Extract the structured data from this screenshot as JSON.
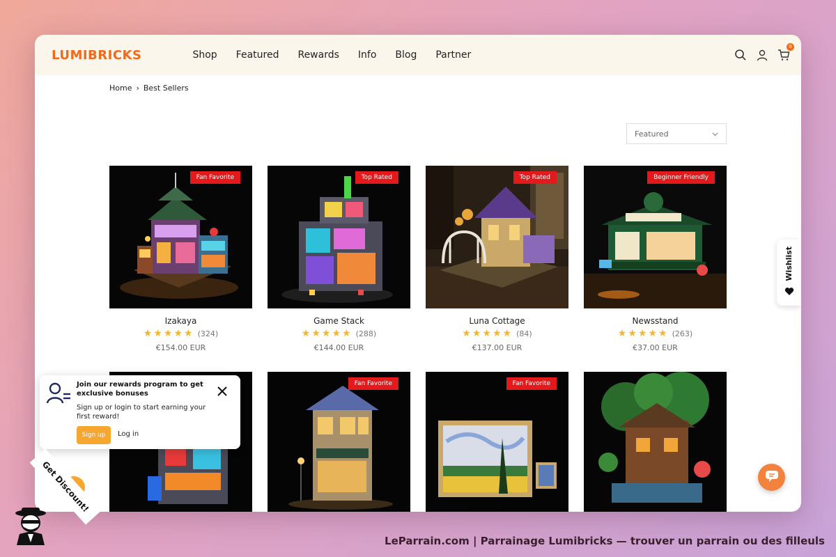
{
  "brand": {
    "logo": "LUMIBRICKS",
    "accent": "#f06a1c"
  },
  "nav": {
    "items": [
      "Shop",
      "Featured",
      "Rewards",
      "Info",
      "Blog",
      "Partner"
    ]
  },
  "header_icons": {
    "search": "search-icon",
    "account": "user-icon",
    "cart": "cart-icon",
    "cart_count": "0"
  },
  "breadcrumb": {
    "home": "Home",
    "separator": "›",
    "current": "Best Sellers"
  },
  "sort": {
    "selected": "Featured"
  },
  "products": [
    {
      "name": "Izakaya",
      "badge": "Fan Favorite",
      "rating": 5,
      "reviews": "(324)",
      "price": "€154.00 EUR"
    },
    {
      "name": "Game Stack",
      "badge": "Top Rated",
      "rating": 5,
      "reviews": "(288)",
      "price": "€144.00 EUR"
    },
    {
      "name": "Luna Cottage",
      "badge": "Top Rated",
      "rating": 5,
      "reviews": "(84)",
      "price": "€137.00 EUR"
    },
    {
      "name": "Newsstand",
      "badge": "Beginner Friendly",
      "rating": 5,
      "reviews": "(263)",
      "price": "€37.00 EUR"
    },
    {
      "name": "",
      "badge": "",
      "rating": 0,
      "reviews": "",
      "price": ""
    },
    {
      "name": "",
      "badge": "Fan Favorite",
      "rating": 0,
      "reviews": "",
      "price": ""
    },
    {
      "name": "",
      "badge": "Fan Favorite",
      "rating": 0,
      "reviews": "",
      "price": ""
    },
    {
      "name": "",
      "badge": "",
      "rating": 0,
      "reviews": "",
      "price": ""
    }
  ],
  "wishlist": {
    "label": "Wishlist"
  },
  "rewards_popup": {
    "title": "Join our rewards program to get exclusive bonuses",
    "body": "Sign up or login to start earning your first reward!",
    "signup": "Sign up",
    "login": "Log in"
  },
  "discount_ribbon": {
    "label": "Get Discount!"
  },
  "footer": {
    "caption": "LeParrain.com | Parrainage Lumibricks — trouver un parrain ou des filleuls"
  },
  "colors": {
    "badge_red": "#e3191b",
    "star": "#f7b52c",
    "signup_orange": "#f7a62f",
    "chat_orange": "#f2823c",
    "header_bg": "#fbf6ec"
  }
}
